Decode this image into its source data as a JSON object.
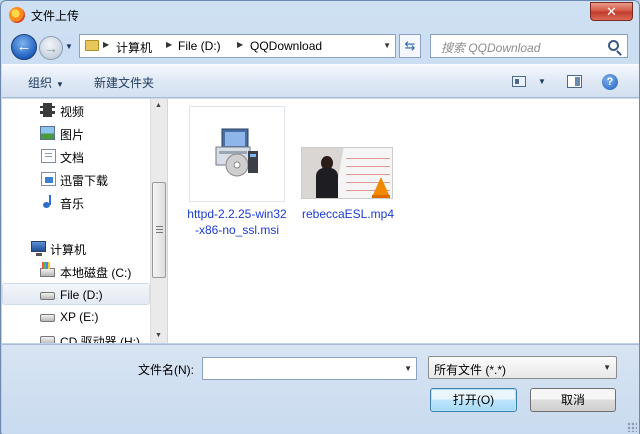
{
  "window": {
    "title": "文件上传",
    "close_glyph": "✕"
  },
  "nav": {
    "back_glyph": "←",
    "forward_glyph": "→",
    "breadcrumb": [
      "计算机",
      "File (D:)",
      "QQDownload"
    ],
    "refresh_glyph": "⇆",
    "search_placeholder": "搜索 QQDownload"
  },
  "toolbar": {
    "organize_label": "组织",
    "new_folder_label": "新建文件夹",
    "help_glyph": "?"
  },
  "sidebar": {
    "items": [
      {
        "label": "视频",
        "icon": "video-icon"
      },
      {
        "label": "图片",
        "icon": "picture-icon"
      },
      {
        "label": "文档",
        "icon": "document-icon"
      },
      {
        "label": "迅雷下载",
        "icon": "download-icon"
      },
      {
        "label": "音乐",
        "icon": "music-icon"
      },
      {
        "label": "计算机",
        "icon": "computer-icon"
      },
      {
        "label": "本地磁盘 (C:)",
        "icon": "local-disk-icon"
      },
      {
        "label": "File (D:)",
        "icon": "drive-icon",
        "selected": true
      },
      {
        "label": "XP (E:)",
        "icon": "drive-icon"
      },
      {
        "label": "CD 驱动器 (H:)",
        "icon": "cd-drive-icon"
      }
    ]
  },
  "files": [
    {
      "name": "httpd-2.2.25-win32-x86-no_ssl.msi",
      "kind": "installer"
    },
    {
      "name": "rebeccaESL.mp4",
      "kind": "video"
    }
  ],
  "footer": {
    "filename_label": "文件名(N):",
    "filename_value": "",
    "filetype_value": "所有文件 (*.*)",
    "open_label": "打开(O)",
    "cancel_label": "取消"
  },
  "colors": {
    "link": "#1b3bd1",
    "accent": "#1f5fbf"
  }
}
